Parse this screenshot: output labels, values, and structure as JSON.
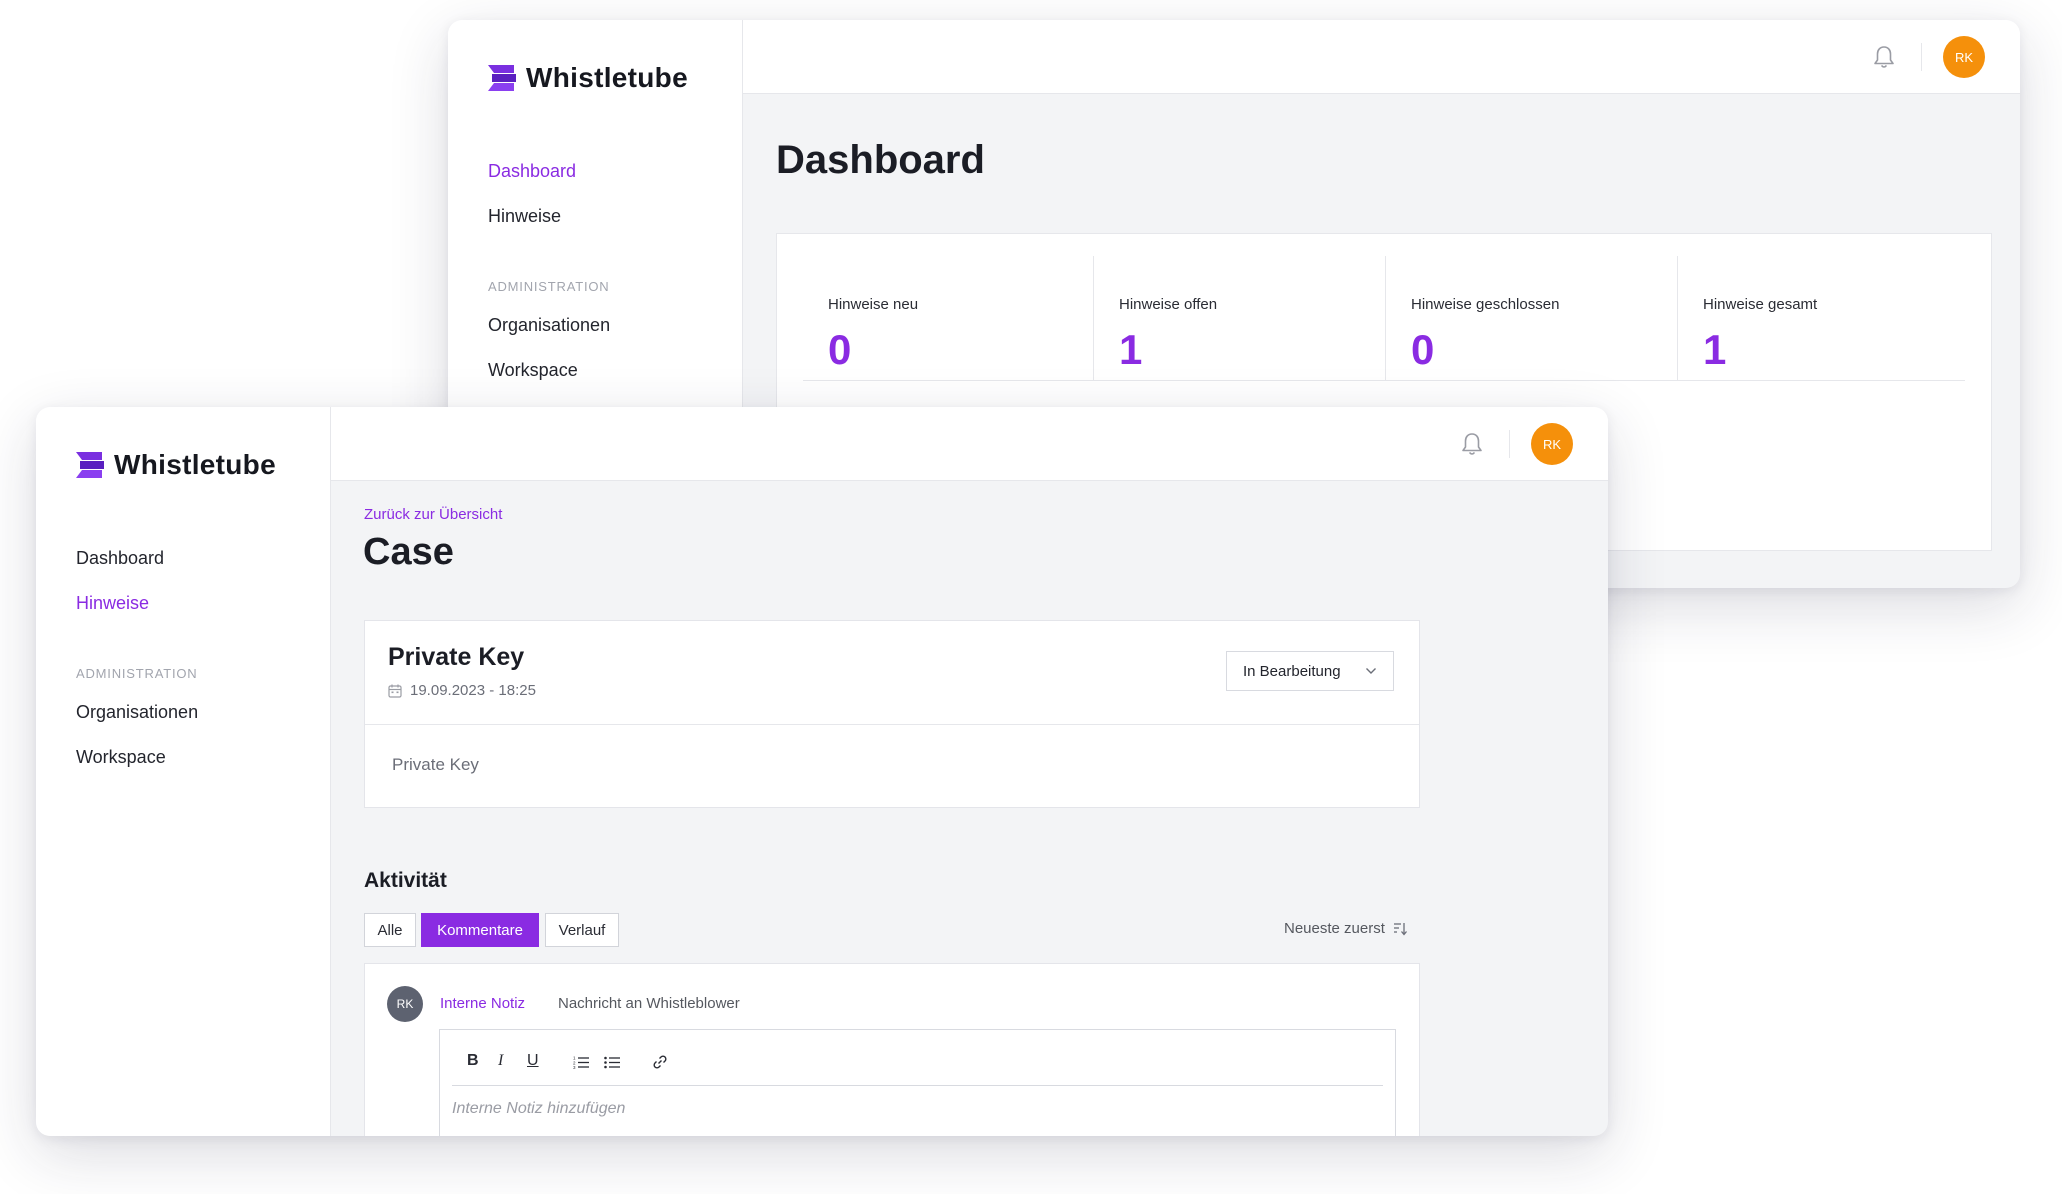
{
  "brand": {
    "name": "Whistletube",
    "accent": "#8a2be2",
    "avatar_color": "#f5900b"
  },
  "back_window": {
    "nav": {
      "dashboard": "Dashboard",
      "hinweise": "Hinweise",
      "section": "ADMINISTRATION",
      "organisationen": "Organisationen",
      "workspace": "Workspace"
    },
    "page_title": "Dashboard",
    "stats": [
      {
        "label": "Hinweise neu",
        "value": "0"
      },
      {
        "label": "Hinweise offen",
        "value": "1"
      },
      {
        "label": "Hinweise geschlossen",
        "value": "0"
      },
      {
        "label": "Hinweise gesamt",
        "value": "1"
      }
    ],
    "avatar": "RK"
  },
  "front_window": {
    "nav": {
      "dashboard": "Dashboard",
      "hinweise": "Hinweise",
      "section": "ADMINISTRATION",
      "organisationen": "Organisationen",
      "workspace": "Workspace"
    },
    "avatar": "RK",
    "back_link": "Zurück zur Übersicht",
    "page_title": "Case",
    "case": {
      "title": "Private Key",
      "date": "19.09.2023 - 18:25",
      "status": "In Bearbeitung",
      "body": "Private Key"
    },
    "activity": {
      "heading": "Aktivität",
      "tabs": [
        "Alle",
        "Kommentare",
        "Verlauf"
      ],
      "active_tab": "Kommentare",
      "sort": "Neueste zuerst",
      "comment_avatar": "RK",
      "mode_internal": "Interne Notiz",
      "mode_message": "Nachricht an Whistleblower",
      "editor_placeholder": "Interne Notiz hinzufügen",
      "toolbar": {
        "bold": "B",
        "italic": "I",
        "underline": "U"
      }
    }
  }
}
